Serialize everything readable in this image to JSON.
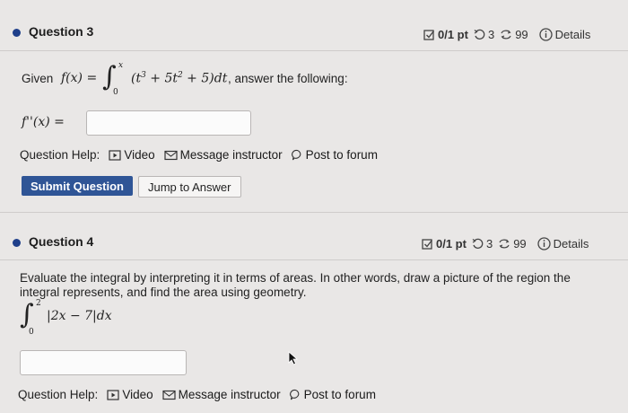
{
  "q3": {
    "title": "Question 3",
    "points": "0/1 pt",
    "tries": "3",
    "retries": "99",
    "details_label": "Details",
    "given_label": "Given",
    "prompt_suffix": ", answer the following:",
    "fx": "f(x) =",
    "upper": "x",
    "lower": "0",
    "integrand": "(t",
    "integrand_mid": " + 5t",
    "integrand_end": " + 5)dt",
    "exp3": "3",
    "exp2": "2",
    "answer_label": "f''(x) =",
    "answer_value": "",
    "help_label": "Question Help:",
    "video": "Video",
    "message": "Message instructor",
    "forum": "Post to forum",
    "submit": "Submit Question",
    "jump": "Jump to Answer"
  },
  "q4": {
    "title": "Question 4",
    "points": "0/1 pt",
    "tries": "3",
    "retries": "99",
    "details_label": "Details",
    "prompt_line1": "Evaluate the integral by interpreting it in terms of areas. In other words, draw a picture of the region the",
    "prompt_line2": "integral represents, and find the area using geometry.",
    "upper": "2",
    "lower": "0",
    "integrand": "|2x − 7|dx",
    "answer_value": "",
    "help_label": "Question Help:",
    "video": "Video",
    "message": "Message instructor",
    "forum": "Post to forum"
  },
  "colors": {
    "bullet": "#1f3f8a",
    "submit_bg": "#2f5596",
    "background": "#e9e7e6"
  }
}
